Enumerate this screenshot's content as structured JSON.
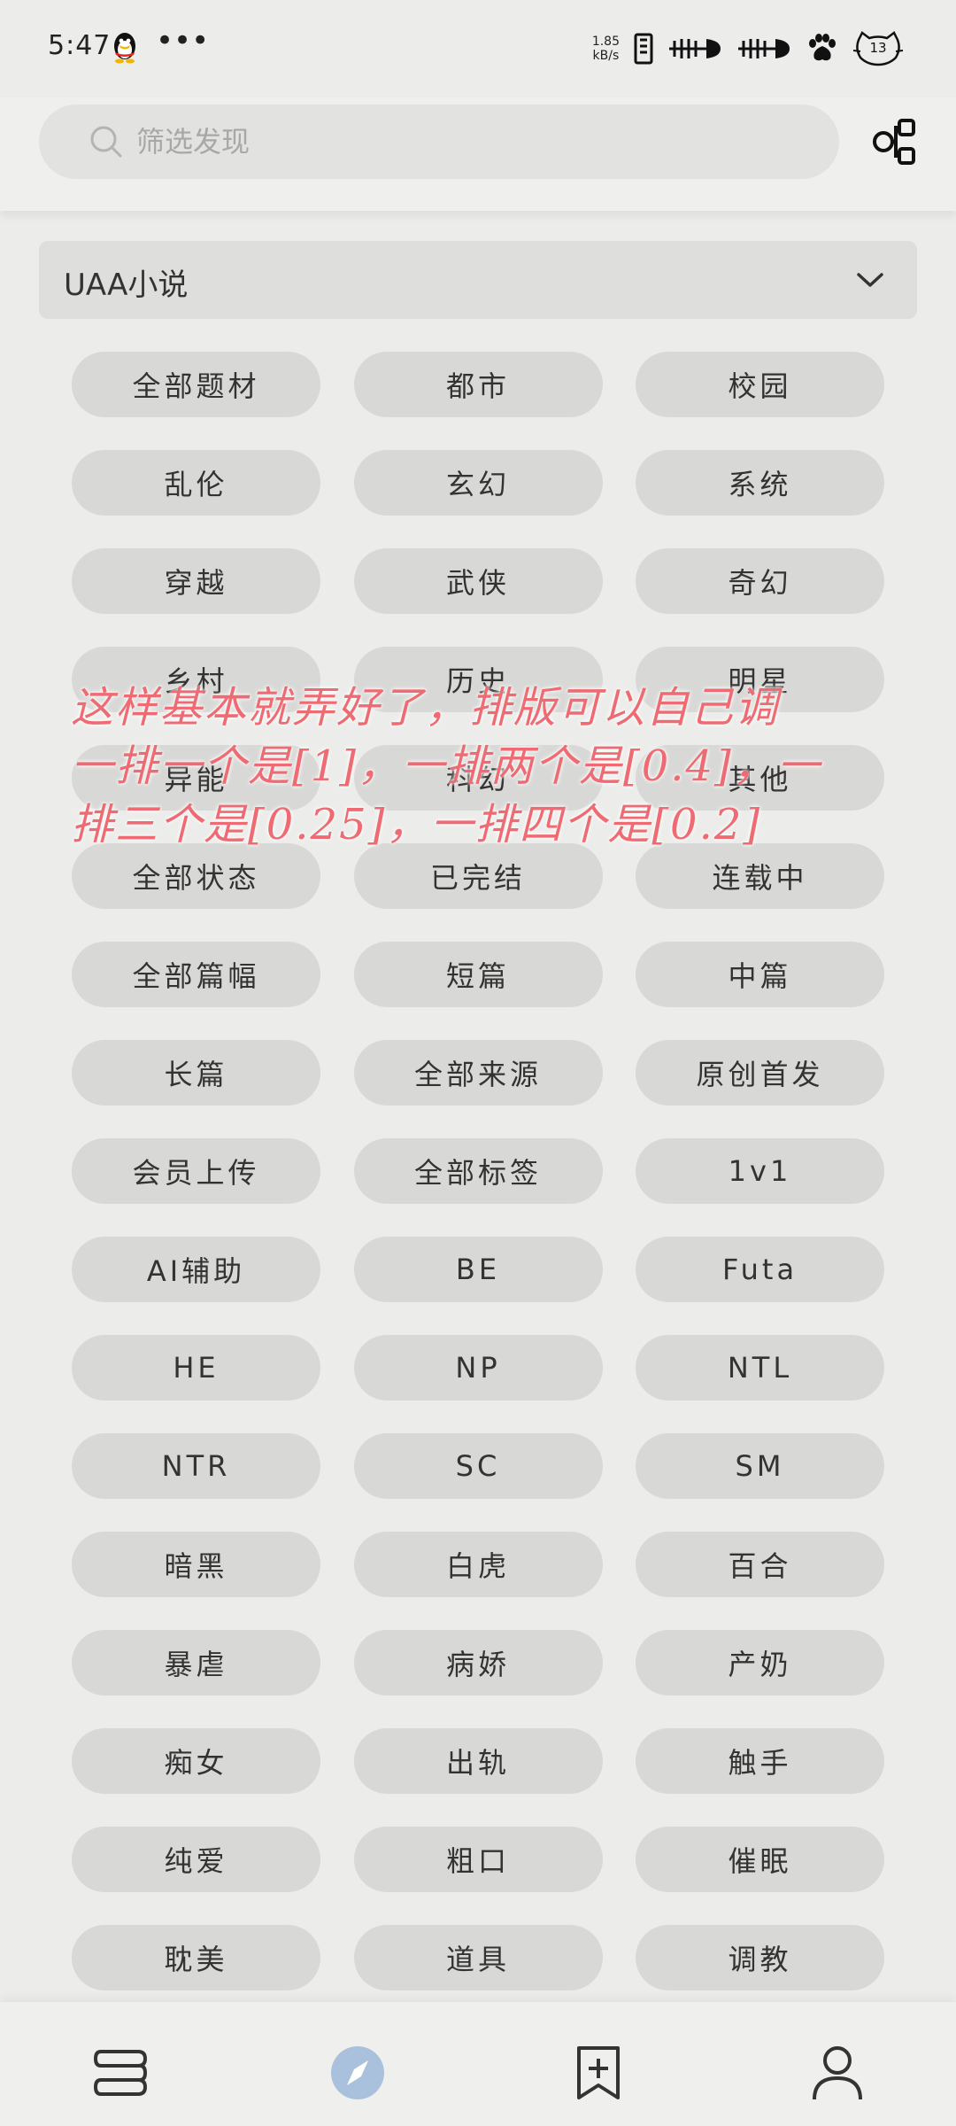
{
  "status_bar": {
    "time": "5:47",
    "dots": "•••",
    "speed_value": "1.85",
    "speed_unit": "kB/s",
    "badge": "13"
  },
  "header": {
    "search_placeholder": "筛选发现"
  },
  "category": {
    "selected": "UAA小说"
  },
  "chips": [
    "全部题材",
    "都市",
    "校园",
    "乱伦",
    "玄幻",
    "系统",
    "穿越",
    "武侠",
    "奇幻",
    "乡村",
    "历史",
    "明星",
    "异能",
    "科幻",
    "其他",
    "全部状态",
    "已完结",
    "连载中",
    "全部篇幅",
    "短篇",
    "中篇",
    "长篇",
    "全部来源",
    "原创首发",
    "会员上传",
    "全部标签",
    "1v1",
    "AI辅助",
    "BE",
    "Futa",
    "HE",
    "NP",
    "NTL",
    "NTR",
    "SC",
    "SM",
    "暗黑",
    "白虎",
    "百合",
    "暴虐",
    "病娇",
    "产奶",
    "痴女",
    "出轨",
    "触手",
    "纯爱",
    "粗口",
    "催眠",
    "耽美",
    "道具",
    "调教"
  ],
  "annotation": {
    "line1": "这样基本就弄好了，排版可以自己调",
    "line2": "一排一个是[1]，一排两个是[0.4]，一",
    "line3": "排三个是[0.25]，一排四个是[0.2]"
  },
  "bottom_nav": {
    "items": [
      "bookshelf-icon",
      "discover-icon",
      "add-bookmark-icon",
      "profile-icon"
    ],
    "active_color": "#a9c1dd"
  }
}
